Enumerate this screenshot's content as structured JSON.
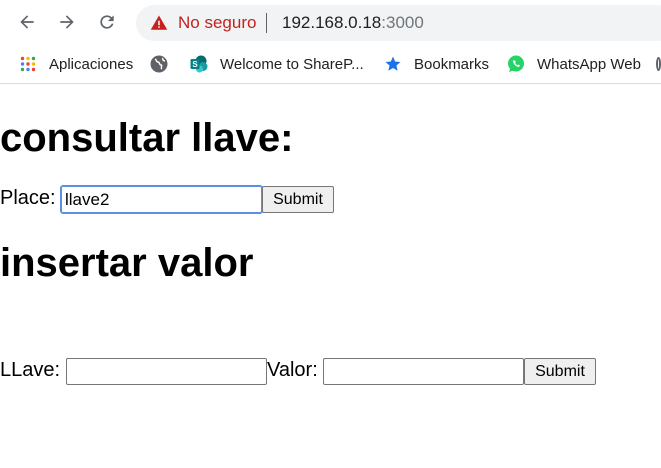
{
  "browser": {
    "security_label": "No seguro",
    "url_host": "192.168.0.18",
    "url_port": ":3000",
    "bookmarks": [
      {
        "label": "Aplicaciones",
        "icon": "apps-grid-icon"
      },
      {
        "label": "",
        "icon": "globe-icon"
      },
      {
        "label": "Welcome to ShareP...",
        "icon": "sharepoint-icon"
      },
      {
        "label": "Bookmarks",
        "icon": "star-icon"
      },
      {
        "label": "WhatsApp Web",
        "icon": "whatsapp-icon"
      }
    ],
    "colors": {
      "insecure": "#c5221f",
      "star": "#1a73e8",
      "whatsapp": "#25d366",
      "sharepoint": "#038387"
    }
  },
  "consult": {
    "heading": "consultar llave:",
    "place_label": "Place:",
    "place_value": "llave2",
    "submit_label": "Submit"
  },
  "insert": {
    "heading": "insertar valor",
    "key_label": "LLave:",
    "key_value": "",
    "value_label": "Valor:",
    "value_value": "",
    "submit_label": "Submit"
  }
}
